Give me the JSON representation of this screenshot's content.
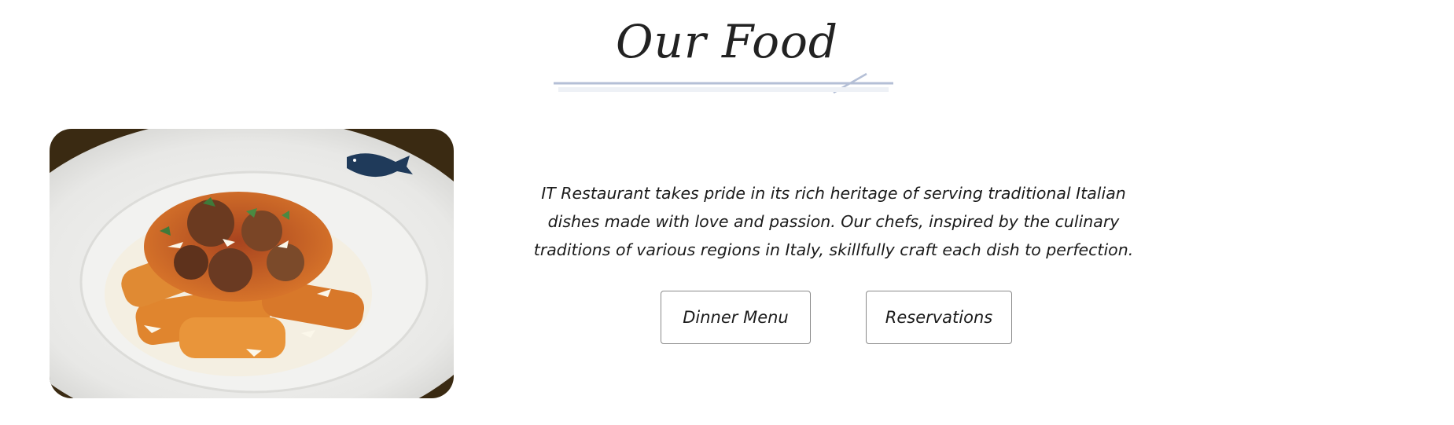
{
  "section": {
    "title": "Our Food"
  },
  "intro": {
    "text": "IT Restaurant takes pride in its rich heritage of serving traditional Italian dishes made with love and passion. Our chefs, inspired by the culinary traditions of various regions in Italy, skillfully craft each dish to perfection."
  },
  "buttons": {
    "dinner_menu": "Dinner Menu",
    "reservations": "Reservations"
  },
  "colors": {
    "title": "#222222",
    "divider": "#b4bfd6",
    "button_border": "#8a8a8a",
    "text": "#1b1b1b"
  },
  "icons": {
    "divider": "divider-flourish-icon"
  }
}
